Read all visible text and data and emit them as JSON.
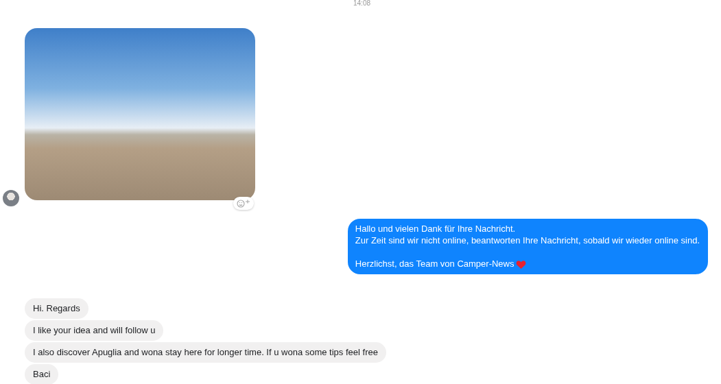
{
  "timestamp": "14:08",
  "outgoing_message": {
    "lines": [
      "Hallo und vielen Dank für Ihre Nachricht.",
      "Zur Zeit sind wir nicht online, beantworten Ihre Nachricht, sobald wir wieder online sind."
    ],
    "signature": "Herzlichst, das Team von Camper-News"
  },
  "incoming_messages": [
    "Hi. Regards",
    "I like your idea and will follow u",
    "I also discover Apuglia and wona stay here for longer time. If u wona some tips feel free",
    "Baci"
  ]
}
